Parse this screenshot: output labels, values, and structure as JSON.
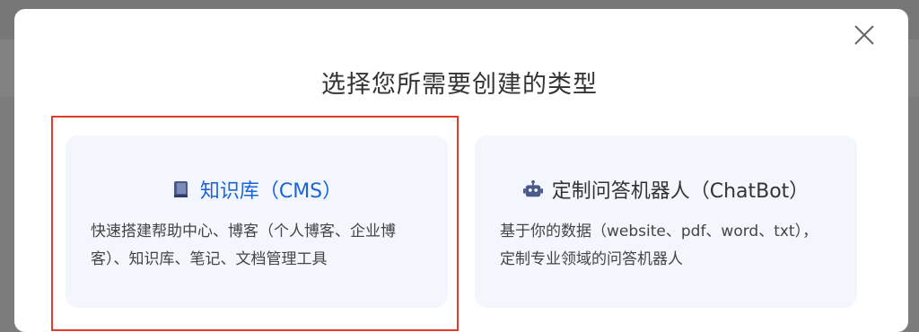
{
  "dialog": {
    "title": "选择您所需要创建的类型"
  },
  "cards": [
    {
      "title": "知识库（CMS）",
      "description": "快速搭建帮助中心、博客（个人博客、企业博客）、知识库、笔记、文档管理工具",
      "icon": "book-icon",
      "selected": true
    },
    {
      "title": "定制问答机器人（ChatBot）",
      "description": "基于你的数据（website、pdf、word、txt），定制专业领域的问答机器人",
      "icon": "robot-icon",
      "selected": false
    }
  ],
  "colors": {
    "accent": "#1b64d8",
    "highlight_border": "#e23b2e",
    "card_background": "#f3f6fd",
    "overlay": "#7c7c7c"
  }
}
